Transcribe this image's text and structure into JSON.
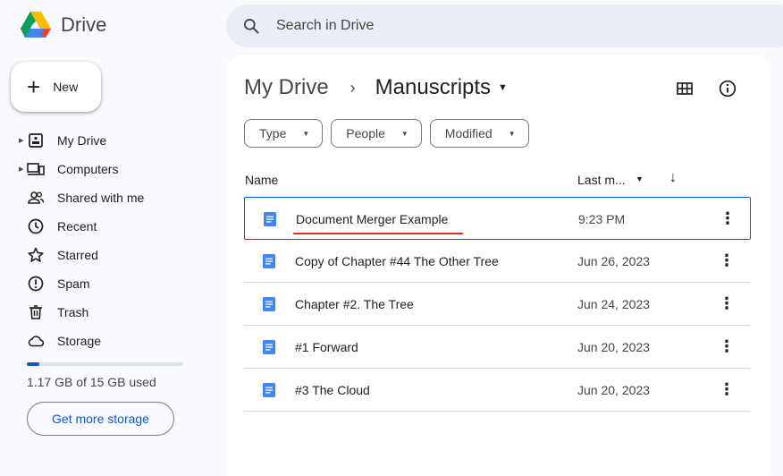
{
  "app": {
    "name": "Drive"
  },
  "search": {
    "placeholder": "Search in Drive"
  },
  "new_button": {
    "label": "New"
  },
  "sidebar": {
    "items": [
      {
        "label": "My Drive",
        "icon": "my-drive-icon",
        "expandable": true
      },
      {
        "label": "Computers",
        "icon": "computers-icon",
        "expandable": true
      },
      {
        "label": "Shared with me",
        "icon": "shared-icon",
        "expandable": false
      },
      {
        "label": "Recent",
        "icon": "clock-icon",
        "expandable": false
      },
      {
        "label": "Starred",
        "icon": "star-icon",
        "expandable": false
      },
      {
        "label": "Spam",
        "icon": "spam-icon",
        "expandable": false
      },
      {
        "label": "Trash",
        "icon": "trash-icon",
        "expandable": false
      },
      {
        "label": "Storage",
        "icon": "cloud-icon",
        "expandable": false
      }
    ]
  },
  "storage": {
    "used_text": "1.17 GB of 15 GB used",
    "fraction_used": 0.078,
    "button_label": "Get more storage"
  },
  "breadcrumb": {
    "root": "My Drive",
    "separator": "›",
    "current": "Manuscripts"
  },
  "filters": [
    {
      "label": "Type"
    },
    {
      "label": "People"
    },
    {
      "label": "Modified"
    }
  ],
  "columns": {
    "name": "Name",
    "modified": "Last m..."
  },
  "files": [
    {
      "name": "Document Merger Example",
      "modified": "9:23 PM",
      "selected": true
    },
    {
      "name": "Copy of Chapter #44 The Other Tree",
      "modified": "Jun 26, 2023",
      "selected": false
    },
    {
      "name": "Chapter #2. The Tree",
      "modified": "Jun 24, 2023",
      "selected": false
    },
    {
      "name": "#1 Forward",
      "modified": "Jun 20, 2023",
      "selected": false
    },
    {
      "name": "#3 The Cloud",
      "modified": "Jun 20, 2023",
      "selected": false
    }
  ],
  "colors": {
    "accent": "#0b57d0",
    "doc_icon": "#4285f4",
    "underline": "#d93025",
    "background": "#f8fafd",
    "search_bg": "#e9eef6"
  }
}
